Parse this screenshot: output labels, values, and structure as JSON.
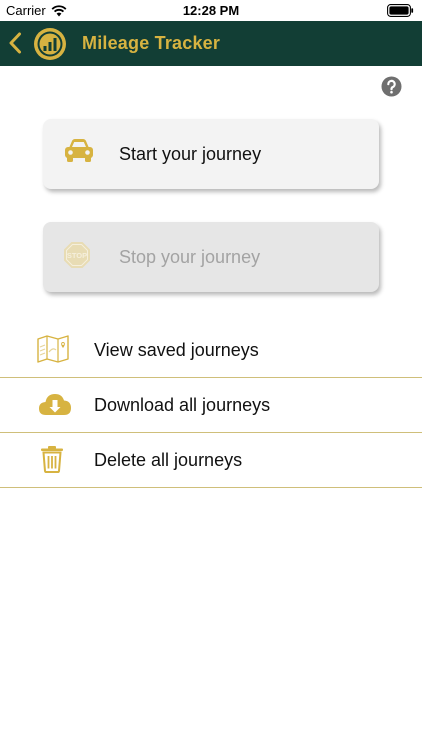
{
  "status_bar": {
    "carrier": "Carrier",
    "time": "12:28 PM"
  },
  "nav": {
    "title": "Mileage Tracker",
    "icons": {
      "back": "chevron-left-icon",
      "logo": "app-logo-icon"
    }
  },
  "help_icon": "question-circle-icon",
  "actions": {
    "start": {
      "label": "Start your journey",
      "icon": "car-icon",
      "enabled": true
    },
    "stop": {
      "label": "Stop your journey",
      "icon": "stop-sign-icon",
      "enabled": false
    }
  },
  "menu": [
    {
      "label": "View saved journeys",
      "icon": "map-icon"
    },
    {
      "label": "Download all journeys",
      "icon": "cloud-download-icon"
    },
    {
      "label": "Delete all journeys",
      "icon": "trash-icon"
    }
  ],
  "colors": {
    "nav_background": "#123e35",
    "accent_gold": "#d7b341",
    "divider": "#cfbf7a",
    "disabled_text": "#a3a3a3"
  }
}
